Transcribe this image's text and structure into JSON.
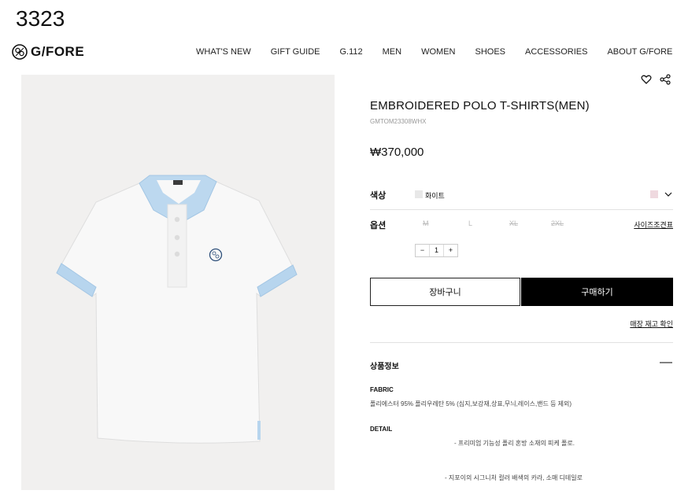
{
  "page_number": "3323",
  "brand": {
    "name": "G/FORE"
  },
  "nav": [
    "WHAT'S NEW",
    "GIFT GUIDE",
    "G.112",
    "MEN",
    "WOMEN",
    "SHOES",
    "ACCESSORIES",
    "ABOUT G/FORE"
  ],
  "product": {
    "title": "EMBROIDERED POLO T-SHIRTS(MEN)",
    "code": "GMTOM23308WHX",
    "price": "₩370,000"
  },
  "color": {
    "label": "색상",
    "selected": "화이트",
    "swatch": "#e8e8e8",
    "alt_swatch": "#efd9df"
  },
  "option": {
    "label": "옵션",
    "sizes": [
      "M",
      "L",
      "XL",
      "2XL"
    ],
    "size_guide": "사이즈조견표",
    "quantity": "1",
    "minus": "−",
    "plus": "+"
  },
  "actions": {
    "cart": "장바구니",
    "buy": "구매하기",
    "stock_check": "매장 재고 확인"
  },
  "info": {
    "title": "상품정보",
    "fabric_label": "FABRIC",
    "fabric_text": "폴리에스터 95% 폴리우레탄 5% (심지,보강재,상표,무늬,레이스,밴드 등 제외)",
    "detail_label": "DETAIL",
    "detail_1": "- 프리미엄 기능성 폴리 혼방 소재의 피케 폴로.",
    "detail_2": "- 지포이의 시그니처 컬러 배색의 카라, 소매 디테일로"
  },
  "colors": {
    "shirt": "#f7f7f7",
    "accent_blue": "#a7cbe8"
  }
}
